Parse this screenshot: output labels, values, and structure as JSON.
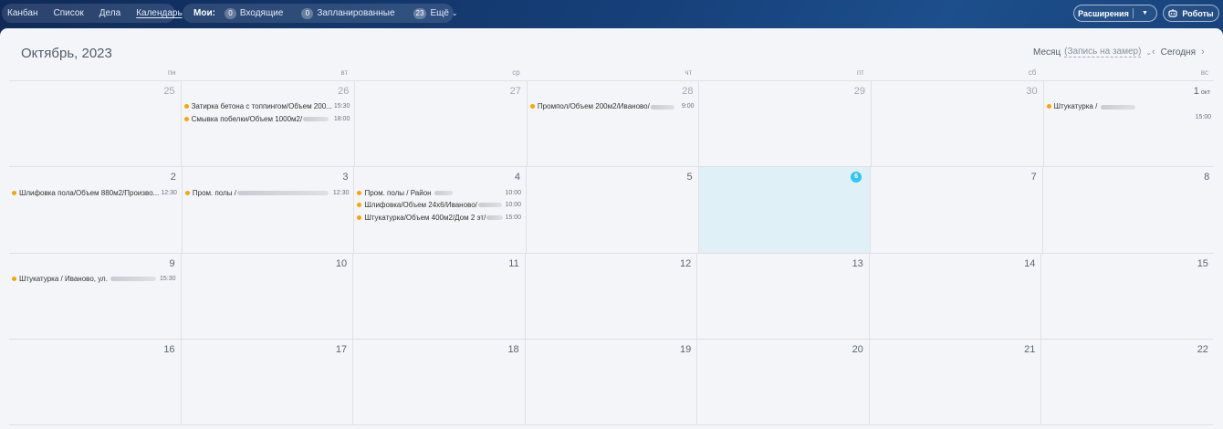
{
  "topbar": {
    "views": [
      "Канбан",
      "Список",
      "Дела",
      "Календарь"
    ],
    "active_view": "Календарь",
    "filters_label": "Мои:",
    "incoming": {
      "count": "0",
      "label": "Входящие"
    },
    "planned": {
      "count": "0",
      "label": "Запланированные"
    },
    "more": {
      "count": "23",
      "label": "Ещё"
    },
    "extensions_label": "Расширения",
    "robots_label": "Роботы"
  },
  "calendar": {
    "title": "Октябрь, 2023",
    "view_mode": "Месяц",
    "view_subtitle": "(Запись на замер)",
    "today_label": "Сегодня",
    "weekdays": [
      "пн",
      "вт",
      "ср",
      "чт",
      "пт",
      "сб",
      "вс"
    ],
    "weeks": [
      [
        {
          "day": "25",
          "other": true,
          "events": []
        },
        {
          "day": "26",
          "other": true,
          "events": [
            {
              "title": "Затирка бетона с топпингом/Объем 200...",
              "time": "15:30",
              "blur": 0
            },
            {
              "title": "Смывка побелки/Объем 1000м2/",
              "time": "18:00",
              "blur": 28
            }
          ]
        },
        {
          "day": "27",
          "other": true,
          "events": []
        },
        {
          "day": "28",
          "other": true,
          "events": [
            {
              "title": "Промпол/Объем 200м2/Иваново/",
              "time": "9:00",
              "blur": 26
            }
          ]
        },
        {
          "day": "29",
          "other": true,
          "events": []
        },
        {
          "day": "30",
          "other": true,
          "events": []
        },
        {
          "day": "1",
          "month": "окт",
          "events": [
            {
              "title": "Штукатурка / ",
              "time": "15:00",
              "blur": 38,
              "time_below": true
            }
          ]
        }
      ],
      [
        {
          "day": "2",
          "events": [
            {
              "title": "Шлифовка пола/Объем 880м2/Произво...",
              "time": "12:30",
              "blur": 0
            }
          ]
        },
        {
          "day": "3",
          "events": [
            {
              "title": "Пром. полы /",
              "time": "12:30",
              "blur": 100
            }
          ]
        },
        {
          "day": "4",
          "events": [
            {
              "title": "Пром. полы / Район ",
              "time": "10:00",
              "blur": 20
            },
            {
              "title": "Шлифовка/Объем 24х6/Иваново/",
              "time": "10:00",
              "blur": 26
            },
            {
              "title": "Штукатурка/Объем 400м2/Дом 2 эт/",
              "time": "15:00",
              "blur": 18
            }
          ]
        },
        {
          "day": "5",
          "events": []
        },
        {
          "day": "6",
          "today": true,
          "events": []
        },
        {
          "day": "7",
          "events": []
        },
        {
          "day": "8",
          "events": []
        }
      ],
      [
        {
          "day": "9",
          "events": [
            {
              "title": "Штукатурка / Иваново, ул. ",
              "time": "15:30",
              "blur": 50
            }
          ]
        },
        {
          "day": "10",
          "events": []
        },
        {
          "day": "11",
          "events": []
        },
        {
          "day": "12",
          "events": []
        },
        {
          "day": "13",
          "events": []
        },
        {
          "day": "14",
          "events": []
        },
        {
          "day": "15",
          "events": []
        }
      ],
      [
        {
          "day": "16",
          "events": []
        },
        {
          "day": "17",
          "events": []
        },
        {
          "day": "18",
          "events": []
        },
        {
          "day": "19",
          "events": []
        },
        {
          "day": "20",
          "events": []
        },
        {
          "day": "21",
          "events": []
        },
        {
          "day": "22",
          "events": []
        }
      ]
    ]
  },
  "colors": {
    "event_dot": "#f7a700",
    "today_bg": "#dff0f6",
    "today_badge": "#2fc6f6"
  }
}
